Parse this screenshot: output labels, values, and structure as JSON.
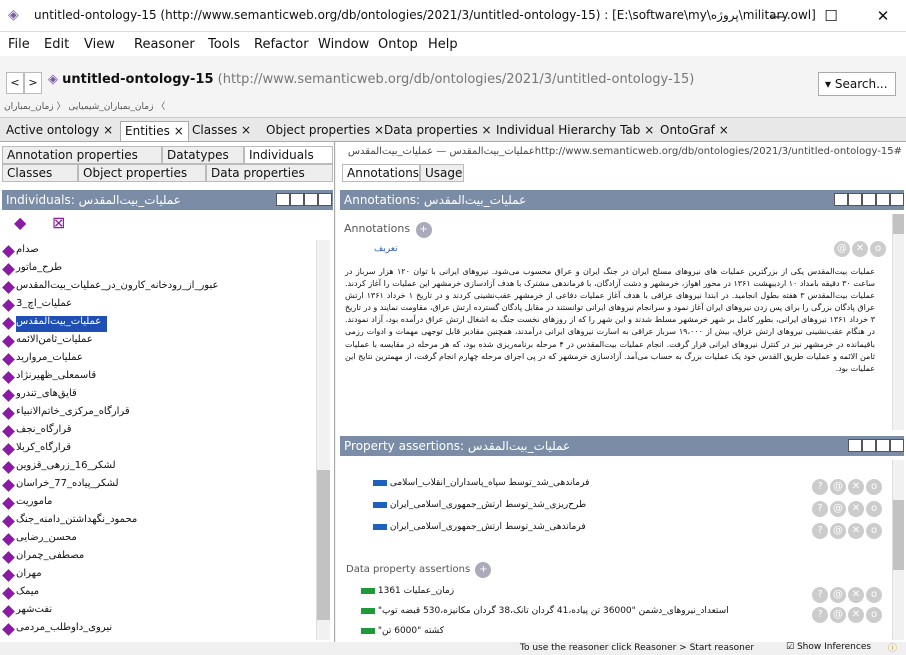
{
  "window": {
    "title": "untitled-ontology-15 (http://www.semanticweb.org/db/ontologies/2021/3/untitled-ontology-15) : [E:\\software\\my\\پروژه\\military.owl]",
    "minimize": "—",
    "maximize": "☐",
    "close": "✕"
  },
  "menu": [
    "File",
    "Edit",
    "View",
    "Reasoner",
    "Tools",
    "Refactor",
    "Window",
    "Ontop",
    "Help"
  ],
  "address": {
    "back": "<",
    "forward": ">",
    "ontology_name": "untitled-ontology-15",
    "ontology_iri": "(http://www.semanticweb.org/db/ontologies/2021/3/untitled-ontology-15)",
    "search_label": "Search...",
    "breadcrumb": "زمان_بمباران_شیمیایی 〈 زمان_بمباران 〈"
  },
  "tabs": [
    "Active ontology",
    "Entities",
    "Classes",
    "Object properties",
    "Data properties",
    "Individual Hierarchy Tab",
    "OntoGraf"
  ],
  "tab_close": "×",
  "left": {
    "subtabs_row1": [
      "Annotation properties",
      "Datatypes",
      "Individuals"
    ],
    "subtabs_row2": [
      "Classes",
      "Object properties",
      "Data properties"
    ],
    "header": "Individuals: عملیات_بیت‌المقدس",
    "items": [
      "صدام",
      "طرح_ماتور",
      "عبور_از_رودخانه_کارون_در_عملیات_بیت‌المقدس",
      "عملیات_اچ_3",
      "عملیات_بیت‌المقدس",
      "عملیات_ثامن‌الائمه",
      "عملیات_مروارید",
      "قاسمعلی_ظهیرنژاد",
      "قایق‌های_تندرو",
      "قرارگاه_مرکزی_خاتم‌الانبیاء",
      "قرارگاه_نجف",
      "قرارگاه_کربلا",
      "لشکر_16_زرهی_قزوین",
      "لشکر_پیاده_77_خراسان",
      "ماموریت",
      "محمود_نگهداشتن_دامنه_جنگ",
      "محسن_رضایی",
      "مصطفی_چمران",
      "مهران",
      "میمک",
      "نفت‌شهر",
      "نیروی_داوطلب_مردمی"
    ],
    "selected_index": 4
  },
  "right": {
    "header": "http://www.semanticweb.org/db/ontologies/2021/3/untitled-ontology-15#عملیات_بیت‌المقدس — عملیات_بیت‌المقدس",
    "subtabs": [
      "Annotations",
      "Usage"
    ],
    "annotations_header": "Annotations: عملیات_بیت‌المقدس",
    "annotations_label": "Annotations",
    "annotation_property": "تعریف",
    "annotation_text": "عملیات بیت‌المقدس یکی از بزرگترین عملیات های نیروهای مسلح ایران در جنگ ایران و عراق محسوب می‌شود. نیروهای ایرانی با توان ۱۲۰ هزار سرباز در ساعت ۳۰ دقیقه بامداد ۱۰ اردیبهشت ۱۳۶۱ در محور اهواز، خرمشهر و دشت آزادگان، با فرماندهی مشترک با هدف آزادسازی خرمشهر این عملیات را آغاز کردند. عملیات بیت‌المقدس ۳ هفته بطول انجامید. در ابتدا نیروهای عراقی با هدف آغاز عملیات دفاعی از خرمشهر عقب‌نشینی کردند و در تاریخ ۱ خرداد ۱۳۶۱ ارتش عراق پادگان بزرگی را برای پس زدن نیروهای ایران آغاز نمود و سرانجام نیروهای ایرانی توانستند در مقابل پادگان گسترده ارتش عراق، مقاومت نمایند و در تاریخ ۳ خرداد ۱۳۶۱ نیروهای ایرانی، بطور کامل بر شهر خرمشهر مسلط شدند و این شهر را که از روزهای نخست جنگ به اشغال ارتش عراق درآمده بود، آزاد نمودند. در هنگام عقب‌نشینی نیروهای ارتش عراق، بیش از ۱۹،۰۰۰ سرباز عراقی به اسارت نیروهای ایرانی درآمدند، همچنین مقادیر قابل توجهی مهمات و ادوات رزمی باقیمانده در خرمشهر نیز در کنترل نیروهای ایرانی قرار گرفت. انجام عملیات بیت‌المقدس در ۴ مرحله برنامه‌ریزی شده بود، که هر مرحله در مقایسه با عملیات ثامن الائمه و عملیات طریق القدس خود یک عملیات بزرگ به حساب می‌آمد. آزادسازی خرمشهر که در پی اجرای مرحله چهارم انجام گرفت، از مهمترین نتایج این عملیات بود.",
    "property_header": "Property assertions: عملیات_بیت‌المقدس",
    "object_assertions": [
      "فرماندهی_شد_توسط سپاه_پاسداران_انقلاب_اسلامی",
      "طرح‌ریزی_شد_توسط ارتش_جمهوری_اسلامی_ایران",
      "فرماندهی_شد_توسط ارتش_جمهوری_اسلامی_ایران"
    ],
    "data_assertions_label": "Data property assertions",
    "data_assertions": [
      "زمان_عملیات 1361",
      "\"استعداد_نیروهای_دشمن \"36000 تن پیاده،41 گردان تانک،38 گردان مکانیزه،530 قبضه توپ",
      "\"کشته \"6000 تن"
    ]
  },
  "status": {
    "text": "To use the reasoner click Reasoner > Start reasoner",
    "show_inferences": "Show Inferences"
  }
}
